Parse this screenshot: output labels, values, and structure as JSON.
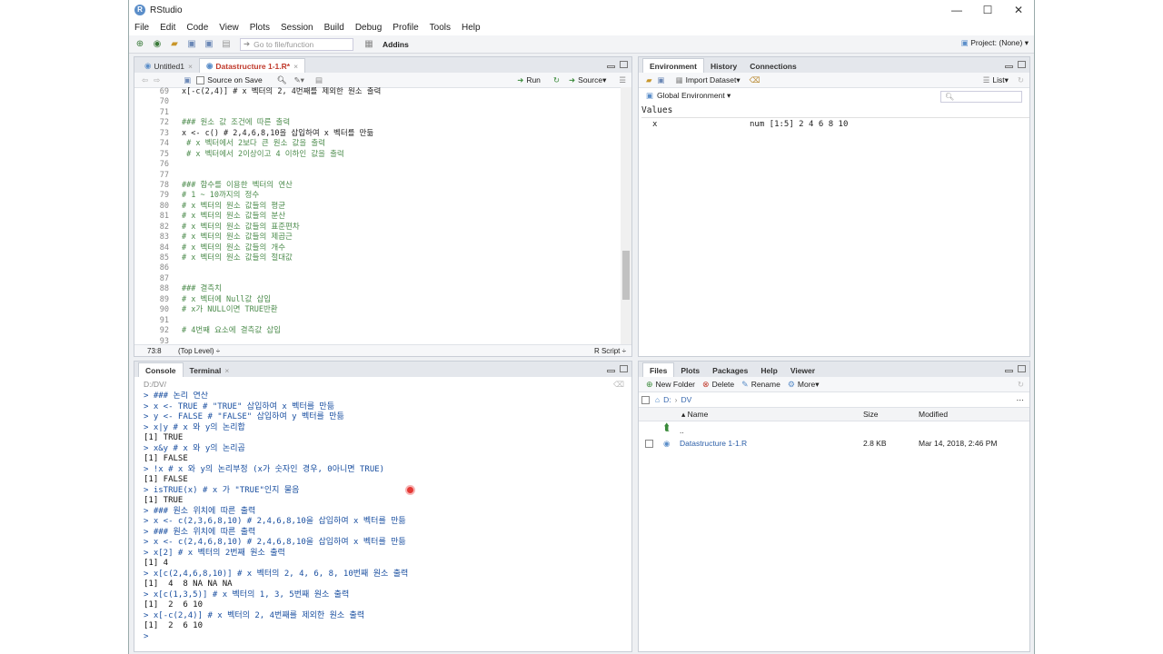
{
  "window": {
    "title": "RStudio",
    "minimize": "—",
    "maximize": "☐",
    "close": "✕"
  },
  "menu": [
    "File",
    "Edit",
    "Code",
    "View",
    "Plots",
    "Session",
    "Build",
    "Debug",
    "Profile",
    "Tools",
    "Help"
  ],
  "toolbar": {
    "goto_placeholder": "Go to file/function",
    "addins": "Addins",
    "project": "Project: (None)"
  },
  "editor": {
    "tabs": [
      {
        "label": "Untitled1",
        "active": false
      },
      {
        "label": "Datastructure 1-1.R*",
        "active": true
      }
    ],
    "source_on_save": "Source on Save",
    "run": "Run",
    "source": "Source",
    "lines": [
      {
        "n": "69",
        "text": "x[-c(2,4)] # x 벡터의 2, 4번째를 제외한 원소 출력"
      },
      {
        "n": "70",
        "text": ""
      },
      {
        "n": "71",
        "text": ""
      },
      {
        "n": "72",
        "text": "### 원소 값 조건에 따른 출력"
      },
      {
        "n": "73",
        "text": "x <- c() # 2,4,6,8,10을 삽입하여 x 벡터를 만듦"
      },
      {
        "n": "74",
        "text": " # x 벡터에서 2보다 큰 원소 값을 출력"
      },
      {
        "n": "75",
        "text": " # x 벡터에서 2이상이고 4 이하인 값을 출력"
      },
      {
        "n": "76",
        "text": ""
      },
      {
        "n": "77",
        "text": ""
      },
      {
        "n": "78",
        "text": "### 함수를 이용한 벡터의 연산"
      },
      {
        "n": "79",
        "text": "# 1 ~ 10까지의 정수"
      },
      {
        "n": "80",
        "text": "# x 벡터의 원소 값들의 평균"
      },
      {
        "n": "81",
        "text": "# x 벡터의 원소 값들의 분산"
      },
      {
        "n": "82",
        "text": "# x 벡터의 원소 값들의 표준편차"
      },
      {
        "n": "83",
        "text": "# x 벡터의 원소 값들의 제곱근"
      },
      {
        "n": "84",
        "text": "# x 벡터의 원소 값들의 개수"
      },
      {
        "n": "85",
        "text": "# x 벡터의 원소 값들의 절대값"
      },
      {
        "n": "86",
        "text": ""
      },
      {
        "n": "87",
        "text": ""
      },
      {
        "n": "88",
        "text": "### 결측치"
      },
      {
        "n": "89",
        "text": "# x 벡터에 Null값 삽입"
      },
      {
        "n": "90",
        "text": "# x가 NULL이면 TRUE반환"
      },
      {
        "n": "91",
        "text": ""
      },
      {
        "n": "92",
        "text": "# 4번째 요소에 결측값 삽입"
      },
      {
        "n": "93",
        "text": ""
      }
    ],
    "status_pos": "73:8",
    "status_scope": "(Top Level) ÷",
    "status_type": "R Script ÷"
  },
  "console": {
    "tabs": [
      "Console",
      "Terminal"
    ],
    "path": "D:/DV/",
    "lines": [
      {
        "t": "in",
        "text": "> ### 논리 연산"
      },
      {
        "t": "in",
        "text": "> x <- TRUE # \"TRUE\" 삽입하여 x 벡터를 만듦"
      },
      {
        "t": "in",
        "text": "> y <- FALSE # \"FALSE\" 삽입하여 y 벡터를 만듦"
      },
      {
        "t": "in",
        "text": "> x|y # x 와 y의 논리합"
      },
      {
        "t": "out",
        "text": "[1] TRUE"
      },
      {
        "t": "in",
        "text": "> x&y # x 와 y의 논리곱"
      },
      {
        "t": "out",
        "text": "[1] FALSE"
      },
      {
        "t": "in",
        "text": "> !x # x 와 y의 논리부정 (x가 숫자인 경우, 0아니면 TRUE)"
      },
      {
        "t": "out",
        "text": "[1] FALSE"
      },
      {
        "t": "in",
        "text": "> isTRUE(x) # x 가 \"TRUE\"인지 물음"
      },
      {
        "t": "out",
        "text": "[1] TRUE"
      },
      {
        "t": "in",
        "text": "> ### 원소 위치에 따른 출력"
      },
      {
        "t": "in",
        "text": "> x <- c(2,3,6,8,10) # 2,4,6,8,10을 삽입하여 x 벡터를 만듦"
      },
      {
        "t": "in",
        "text": "> ### 원소 위치에 따른 출력"
      },
      {
        "t": "in",
        "text": "> x <- c(2,4,6,8,10) # 2,4,6,8,10을 삽입하여 x 벡터를 만듦"
      },
      {
        "t": "in",
        "text": "> x[2] # x 벡터의 2번째 원소 출력"
      },
      {
        "t": "out",
        "text": "[1] 4"
      },
      {
        "t": "in",
        "text": "> x[c(2,4,6,8,10)] # x 벡터의 2, 4, 6, 8, 10번째 원소 출력"
      },
      {
        "t": "out",
        "text": "[1]  4  8 NA NA NA"
      },
      {
        "t": "in",
        "text": "> x[c(1,3,5)] # x 벡터의 1, 3, 5번째 원소 출력"
      },
      {
        "t": "out",
        "text": "[1]  2  6 10"
      },
      {
        "t": "in",
        "text": "> x[-c(2,4)] # x 벡터의 2, 4번째를 제외한 원소 출력"
      },
      {
        "t": "out",
        "text": "[1]  2  6 10"
      },
      {
        "t": "in",
        "text": "> "
      }
    ]
  },
  "environment": {
    "tabs": [
      "Environment",
      "History",
      "Connections"
    ],
    "import": "Import Dataset",
    "list": "List",
    "scope": "Global Environment",
    "section": "Values",
    "vars": [
      {
        "name": "x",
        "value": "num [1:5] 2 4 6 8 10"
      }
    ]
  },
  "files": {
    "tabs": [
      "Files",
      "Plots",
      "Packages",
      "Help",
      "Viewer"
    ],
    "new_folder": "New Folder",
    "delete": "Delete",
    "rename": "Rename",
    "more": "More",
    "crumb_root": "D:",
    "crumb_dir": "DV",
    "col_name": "Name",
    "col_size": "Size",
    "col_modified": "Modified",
    "up": "..",
    "rows": [
      {
        "name": "Datastructure 1-1.R",
        "size": "2.8 KB",
        "modified": "Mar 14, 2018, 2:46 PM"
      }
    ]
  }
}
